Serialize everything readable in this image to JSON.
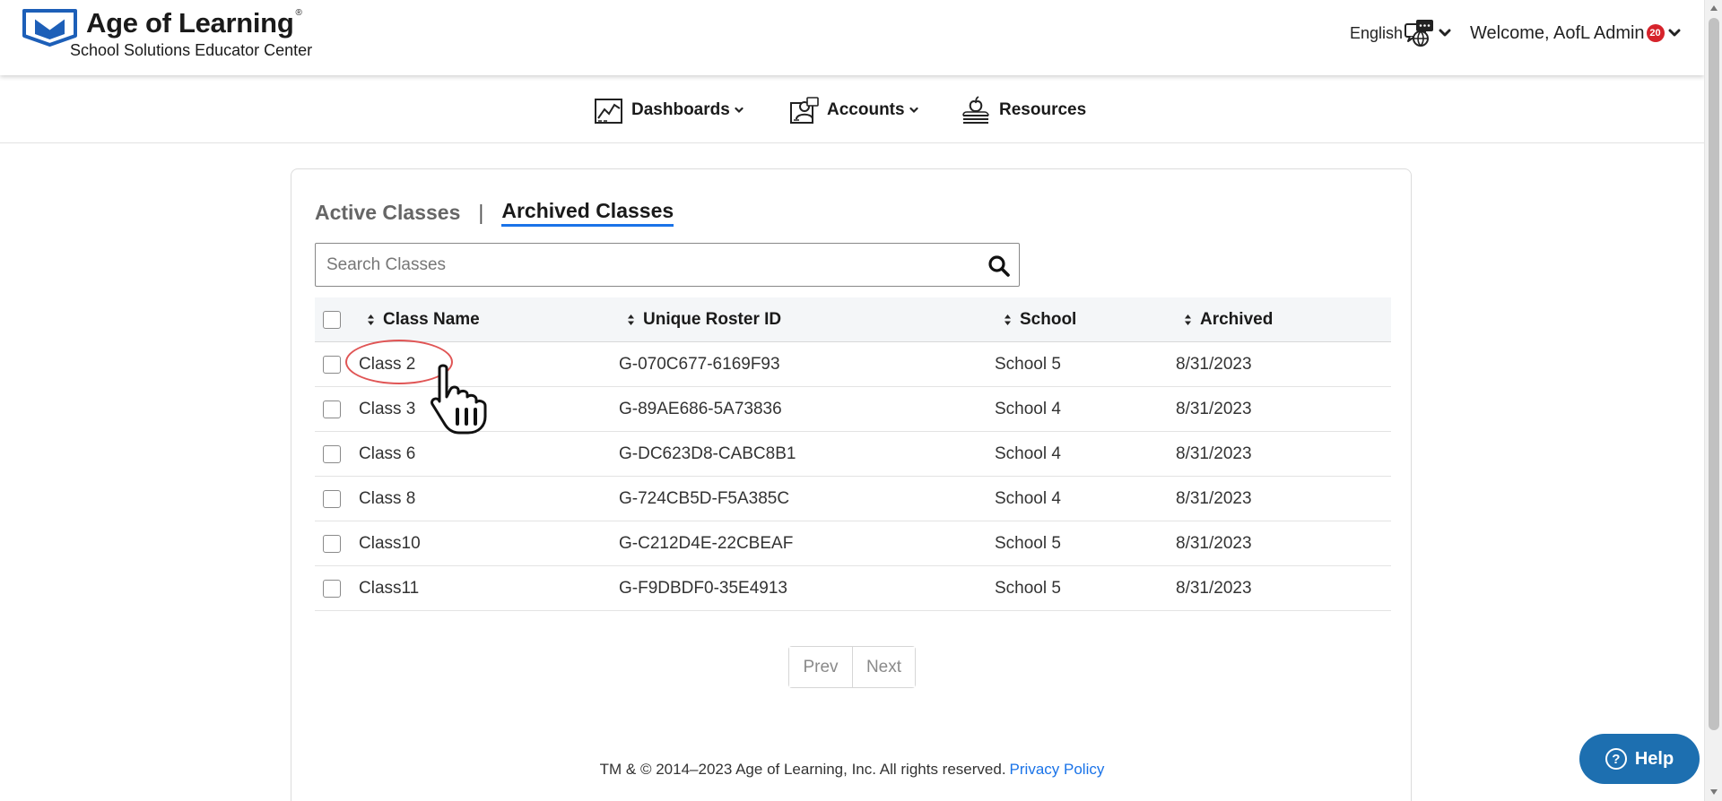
{
  "header": {
    "brand_title": "Age of Learning",
    "brand_reg": "®",
    "brand_subtitle": "School Solutions Educator Center",
    "language": "English",
    "welcome": "Welcome, AofL Admin",
    "notification_count": "20"
  },
  "nav": {
    "items": [
      {
        "label": "Dashboards",
        "icon": "chart-icon",
        "has_dropdown": true
      },
      {
        "label": "Accounts",
        "icon": "accounts-icon",
        "has_dropdown": true
      },
      {
        "label": "Resources",
        "icon": "resources-icon",
        "has_dropdown": false
      }
    ]
  },
  "tabs": {
    "active_classes": "Active Classes",
    "separator": "|",
    "archived_classes": "Archived Classes",
    "selected": "archived_classes"
  },
  "search": {
    "placeholder": "Search Classes",
    "value": ""
  },
  "table": {
    "columns": [
      "Class Name",
      "Unique Roster ID",
      "School",
      "Archived"
    ],
    "rows": [
      {
        "class_name": "Class 2",
        "roster_id": "G-070C677-6169F93",
        "school": "School 5",
        "archived": "8/31/2023"
      },
      {
        "class_name": "Class 3",
        "roster_id": "G-89AE686-5A73836",
        "school": "School 4",
        "archived": "8/31/2023"
      },
      {
        "class_name": "Class 6",
        "roster_id": "G-DC623D8-CABC8B1",
        "school": "School 4",
        "archived": "8/31/2023"
      },
      {
        "class_name": "Class 8",
        "roster_id": "G-724CB5D-F5A385C",
        "school": "School 4",
        "archived": "8/31/2023"
      },
      {
        "class_name": "Class10",
        "roster_id": "G-C212D4E-22CBEAF",
        "school": "School 5",
        "archived": "8/31/2023"
      },
      {
        "class_name": "Class11",
        "roster_id": "G-F9DBDF0-35E4913",
        "school": "School 5",
        "archived": "8/31/2023"
      }
    ]
  },
  "pagination": {
    "prev": "Prev",
    "next": "Next"
  },
  "footer": {
    "text": "TM & © 2014–2023 Age of Learning, Inc. All rights reserved.",
    "privacy_link": "Privacy Policy"
  },
  "help": {
    "label": "Help",
    "icon_glyph": "?"
  },
  "colors": {
    "brand_blue": "#1d5fb8",
    "link_blue": "#1a73e8",
    "badge_red": "#d6232b",
    "help_blue": "#1d6fb0",
    "highlight_red": "#e05555"
  }
}
